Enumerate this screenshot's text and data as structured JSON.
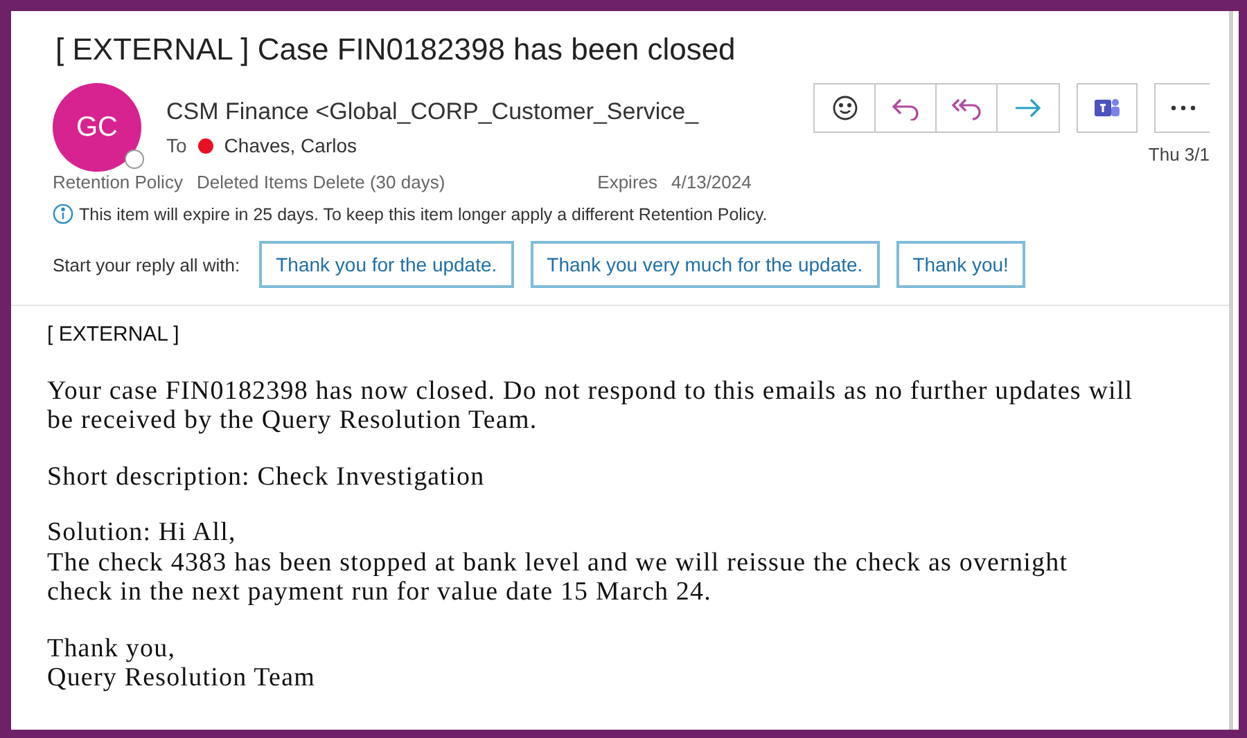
{
  "subject": "[ EXTERNAL ] Case FIN0182398 has been closed",
  "sender": {
    "initials": "GC",
    "name": "CSM Finance <Global_CORP_Customer_Service_",
    "to_label": "To",
    "recipients": [
      {
        "name": "Chaves, Carlos",
        "color": "#e81123"
      }
    ],
    "date": "Thu 3/1"
  },
  "retention": {
    "label": "Retention Policy",
    "policy": "Deleted Items Delete (30 days)",
    "expires_label": "Expires",
    "expires": "4/13/2024"
  },
  "info": "This item will expire in 25 days. To keep this item longer apply a different Retention Policy.",
  "suggested_replies": {
    "label": "Start your reply all with:",
    "options": [
      "Thank you for the update.",
      "Thank you very much for the update.",
      "Thank you!"
    ]
  },
  "body": {
    "tag": "[ EXTERNAL ]",
    "paragraphs": [
      [
        "Your case FIN0182398 has now closed. Do not respond to this emails as no further updates will",
        "be received by the Query Resolution Team."
      ],
      [
        "Short description: Check Investigation"
      ],
      [
        "Solution: Hi All,",
        "The check 4383 has been stopped at bank level and we will reissue the check as overnight",
        "check in the next payment run for value date 15 March 24."
      ],
      [
        "Thank you,",
        "Query Resolution Team"
      ]
    ]
  }
}
